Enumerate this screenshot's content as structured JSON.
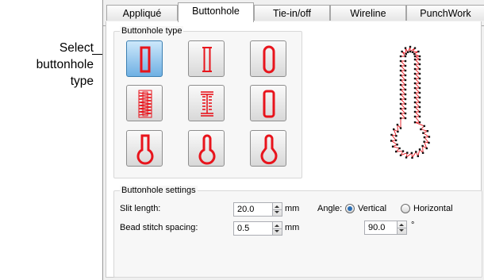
{
  "callout": {
    "line1": "Select",
    "line2": "buttonhole",
    "line3": "type"
  },
  "tabs": [
    "Appliqué",
    "Buttonhole",
    "Tie-in/off",
    "Wireline",
    "PunchWork"
  ],
  "buttonhole_type": {
    "group_label": "Buttonhole type",
    "buttons": [
      {
        "name": "straight-bar-icon",
        "selected": true
      },
      {
        "name": "thin-bar-icon",
        "selected": false
      },
      {
        "name": "rounded-bar-icon",
        "selected": false
      },
      {
        "name": "zigzag-bar-icon",
        "selected": false
      },
      {
        "name": "bartack-bar-icon",
        "selected": false
      },
      {
        "name": "oval-bar-icon",
        "selected": false
      },
      {
        "name": "keyhole-square-icon",
        "selected": false
      },
      {
        "name": "keyhole-round-icon",
        "selected": false
      },
      {
        "name": "keyhole-taper-icon",
        "selected": false
      }
    ]
  },
  "settings": {
    "group_label": "Buttonhole settings",
    "slit_length_label": "Slit length:",
    "slit_length_value": "20.0",
    "slit_length_unit": "mm",
    "bead_spacing_label": "Bead stitch spacing:",
    "bead_spacing_value": "0.5",
    "bead_spacing_unit": "mm",
    "angle_label": "Angle:",
    "vertical_label": "Vertical",
    "horizontal_label": "Horizontal",
    "angle_value": "90.0",
    "angle_unit": "°"
  },
  "colors": {
    "accent": "#e8141c",
    "selected": "#6fb0e3"
  }
}
